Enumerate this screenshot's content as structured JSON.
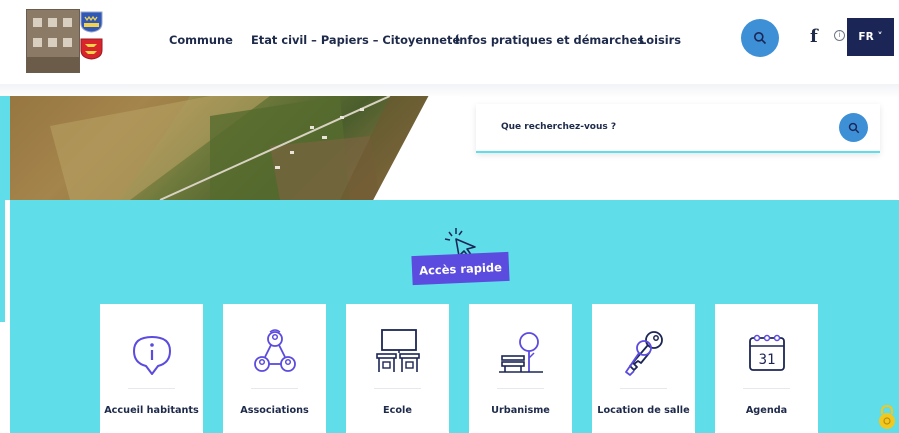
{
  "header": {
    "nav": [
      {
        "label": "Commune"
      },
      {
        "label": "Etat civil – Papiers – Citoyenneté"
      },
      {
        "label": "Infos pratiques et démarches"
      },
      {
        "label": "Loisirs"
      }
    ],
    "search_icon": "search-icon",
    "facebook": "f",
    "info": "i",
    "lang": "FR ˅"
  },
  "search": {
    "placeholder": "Que recherchez-vous ?"
  },
  "quick_access": {
    "title": "Accès rapide",
    "cards": [
      {
        "label": "Accueil habitants",
        "icon": "info-pin-icon"
      },
      {
        "label": "Associations",
        "icon": "network-people-icon"
      },
      {
        "label": "Ecole",
        "icon": "classroom-icon"
      },
      {
        "label": "Urbanisme",
        "icon": "urban-bench-tree-icon"
      },
      {
        "label": "Location de salle",
        "icon": "keys-icon"
      },
      {
        "label": "Agenda",
        "icon": "calendar-icon"
      }
    ],
    "agenda_day": "31"
  },
  "colors": {
    "accent_teal": "#5fdde8",
    "accent_purple": "#5b4bde",
    "navy": "#1c2656",
    "search_blue": "#3d8fd6"
  }
}
